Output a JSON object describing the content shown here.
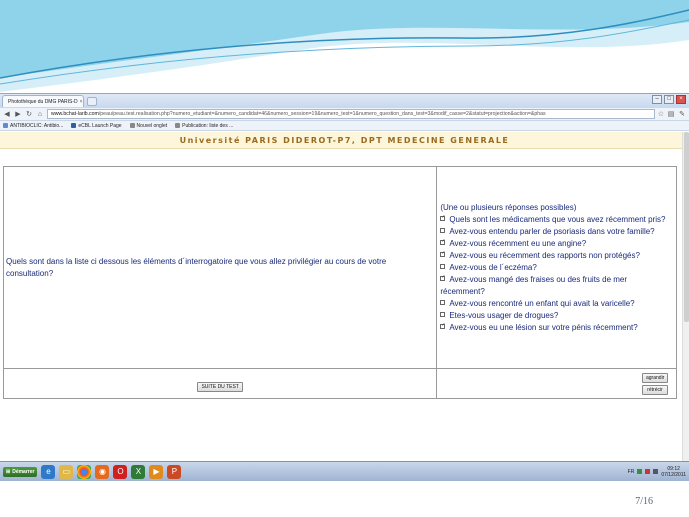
{
  "browser": {
    "tab_title": "Photothèque du DMG PARIS-D",
    "url_host": "www.bchat-larib.com",
    "url_path": "/peau/peau.test.realisation.php?numero_etudiant=&numero_candidat=46&numero_session=19&numero_test=1&numero_question_dans_test=3&modif_casse=2&statut=projection&action=&phas",
    "bookmarks": [
      "ANTIBIOCLIC: Antibio...",
      "eCBL Launch Page",
      "Nouvel onglet",
      "Publication: liste des ..."
    ]
  },
  "page": {
    "header": "Université PARIS DIDEROT-P7, DPT MEDECINE GENERALE",
    "question": "Quels sont dans la liste ci dessous les éléments d´interrogatoire que vous allez privilégier au cours de votre consultation?",
    "answer_hint": "(Une ou plusieurs réponses possibles)",
    "options": [
      {
        "label": "Quels sont les médicaments que vous avez récemment pris?",
        "checked": true
      },
      {
        "label": "Avez-vous entendu parler de psoriasis dans votre famille?",
        "checked": false
      },
      {
        "label": "Avez-vous récemment eu une angine?",
        "checked": true
      },
      {
        "label": "Avez-vous eu récemment des rapports non protégés?",
        "checked": true
      },
      {
        "label": "Avez-vous de l´eczéma?",
        "checked": false
      },
      {
        "label": "Avez-vous mangé des fraises ou des fruits de mer récemment?",
        "checked": true
      },
      {
        "label": "Avez-vous rencontré un enfant qui avait la varicelle?",
        "checked": false
      },
      {
        "label": "Etes-vous usager de drogues?",
        "checked": false
      },
      {
        "label": "Avez-vous eu une lésion sur votre pénis récemment?",
        "checked": true
      }
    ],
    "next_button": "SUITE DU TEST",
    "enlarge_button": "agrandir",
    "shrink_button": "rétrécir"
  },
  "taskbar": {
    "start_label": "Démarrer",
    "lang": "FR",
    "time": "09:12",
    "date": "07/12/2011"
  },
  "slide": {
    "page_number": "7/16"
  }
}
